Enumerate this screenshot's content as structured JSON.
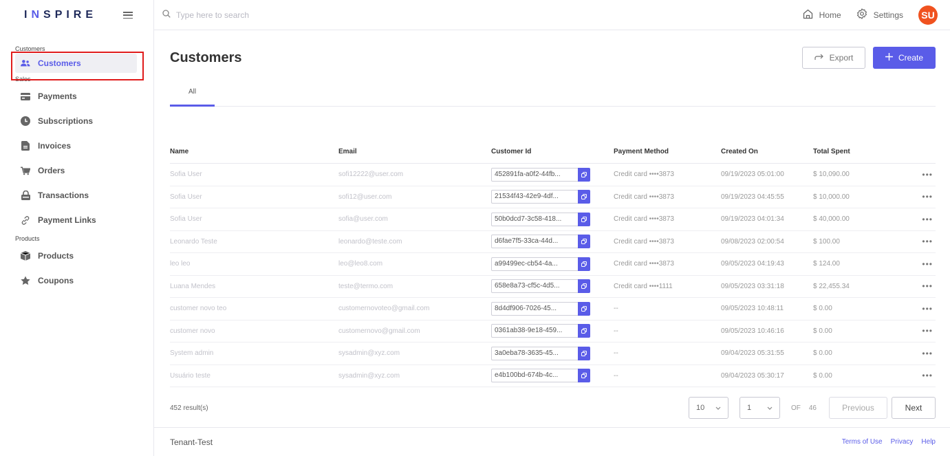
{
  "app": {
    "logo_text_1": "I",
    "logo_accent": "N",
    "logo_text_2": "SPIRE"
  },
  "sidebar": {
    "sections": [
      {
        "label": "Customers",
        "items": [
          {
            "label": "Customers",
            "icon": "users-icon"
          }
        ]
      },
      {
        "label": "Sales",
        "items": [
          {
            "label": "Payments",
            "icon": "credit-card-icon"
          },
          {
            "label": "Subscriptions",
            "icon": "clock-icon"
          },
          {
            "label": "Invoices",
            "icon": "file-icon"
          },
          {
            "label": "Orders",
            "icon": "cart-icon"
          },
          {
            "label": "Transactions",
            "icon": "lock-icon"
          },
          {
            "label": "Payment Links",
            "icon": "link-icon"
          }
        ]
      },
      {
        "label": "Products",
        "items": [
          {
            "label": "Products",
            "icon": "box-icon"
          },
          {
            "label": "Coupons",
            "icon": "star-icon"
          }
        ]
      }
    ]
  },
  "topbar": {
    "search_placeholder": "Type here to search",
    "home_label": "Home",
    "settings_label": "Settings",
    "avatar_initials": "SU"
  },
  "page": {
    "title": "Customers",
    "export_label": "Export",
    "create_label": "Create",
    "tab_all": "All"
  },
  "table": {
    "headers": {
      "name": "Name",
      "email": "Email",
      "customer_id": "Customer Id",
      "payment_method": "Payment Method",
      "created_on": "Created On",
      "total_spent": "Total Spent"
    },
    "rows": [
      {
        "name": "Sofia User",
        "email": "sofi12222@user.com",
        "id": "452891fa-a0f2-44fb...",
        "pm": "Credit card ••••3873",
        "date": "09/19/2023 05:01:00",
        "total": "$ 10,090.00"
      },
      {
        "name": "Sofia User",
        "email": "sofi12@user.com",
        "id": "21534f43-42e9-4df...",
        "pm": "Credit card ••••3873",
        "date": "09/19/2023 04:45:55",
        "total": "$ 10,000.00"
      },
      {
        "name": "Sofia User",
        "email": "sofia@user.com",
        "id": "50b0dcd7-3c58-418...",
        "pm": "Credit card ••••3873",
        "date": "09/19/2023 04:01:34",
        "total": "$ 40,000.00"
      },
      {
        "name": "Leonardo Teste",
        "email": "leonardo@teste.com",
        "id": "d6fae7f5-33ca-44d...",
        "pm": "Credit card ••••3873",
        "date": "09/08/2023 02:00:54",
        "total": "$ 100.00"
      },
      {
        "name": "leo leo",
        "email": "leo@leo8.com",
        "id": "a99499ec-cb54-4a...",
        "pm": "Credit card ••••3873",
        "date": "09/05/2023 04:19:43",
        "total": "$ 124.00"
      },
      {
        "name": "Luana Mendes",
        "email": "teste@termo.com",
        "id": "658e8a73-cf5c-4d5...",
        "pm": "Credit card ••••1111",
        "date": "09/05/2023 03:31:18",
        "total": "$ 22,455.34"
      },
      {
        "name": "customer novo teo",
        "email": "customernovoteo@gmail.com",
        "id": "8d4df906-7026-45...",
        "pm": "--",
        "date": "09/05/2023 10:48:11",
        "total": "$ 0.00"
      },
      {
        "name": "customer novo",
        "email": "customernovo@gmail.com",
        "id": "0361ab38-9e18-459...",
        "pm": "--",
        "date": "09/05/2023 10:46:16",
        "total": "$ 0.00"
      },
      {
        "name": "System admin",
        "email": "sysadmin@xyz.com",
        "id": "3a0eba78-3635-45...",
        "pm": "--",
        "date": "09/04/2023 05:31:55",
        "total": "$ 0.00"
      },
      {
        "name": "Usuário teste",
        "email": "sysadmin@xyz.com",
        "id": "e4b100bd-674b-4c...",
        "pm": "--",
        "date": "09/04/2023 05:30:17",
        "total": "$ 0.00"
      }
    ]
  },
  "pager": {
    "results": "452 result(s)",
    "page_size": "10",
    "current_page": "1",
    "of_label": "OF",
    "total_pages": "46",
    "previous_label": "Previous",
    "next_label": "Next"
  },
  "footer": {
    "tenant": "Tenant-Test",
    "terms": "Terms of Use",
    "privacy": "Privacy",
    "help": "Help"
  },
  "colors": {
    "accent": "#5a5ce8",
    "avatar": "#f0521f",
    "highlight": "#e01b1b"
  }
}
